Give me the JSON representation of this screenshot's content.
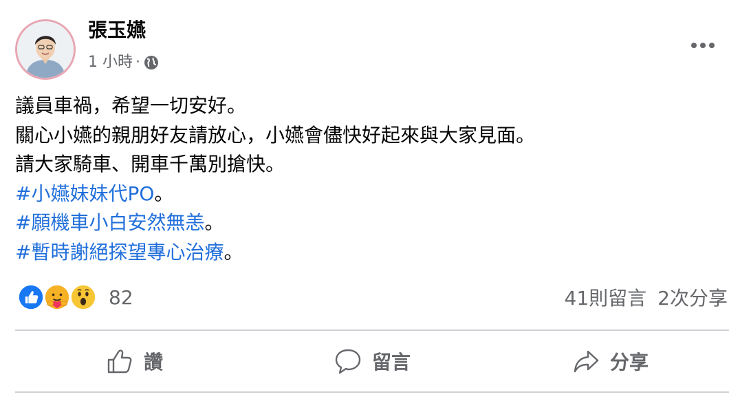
{
  "colors": {
    "link": "#216fdb",
    "secondary_text": "#65676b",
    "divider": "#ced0d4",
    "like_blue": "#1877f2"
  },
  "header": {
    "author": "張玉嬿",
    "time": "1 小時",
    "separator": "·",
    "audience_icon": "globe-icon",
    "more_icon": "more-horizontal-icon"
  },
  "post": {
    "lines": [
      "議員車禍，希望一切安好。",
      "關心小嬿的親朋好友請放心，小嬿會儘快好起來與大家見面。",
      "請大家騎車、開車千萬別搶快。"
    ],
    "hashtags": [
      {
        "tag": "#小嬿妹妹代PO",
        "suffix": "。"
      },
      {
        "tag": "#願機車小白安然無恙",
        "suffix": "。"
      },
      {
        "tag": "#暫時謝絕探望專心治療",
        "suffix": "。"
      }
    ]
  },
  "reactions": {
    "icons": [
      "like-reaction-icon",
      "care-reaction-icon",
      "wow-reaction-icon"
    ],
    "count": "82",
    "comments": "41則留言",
    "shares": "2次分享"
  },
  "actions": {
    "like": "讚",
    "comment": "留言",
    "share": "分享"
  }
}
